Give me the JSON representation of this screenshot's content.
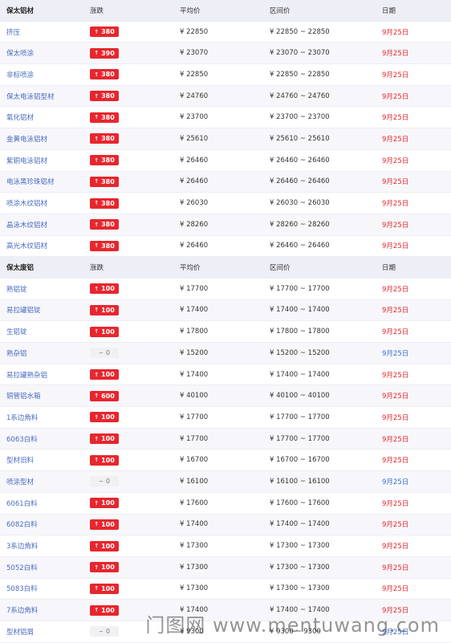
{
  "colors": {
    "up": "#e8262d",
    "header_bg": "#eeeef6",
    "link": "#4a6bbf",
    "date_blue": "#3a6fd8"
  },
  "sections": [
    {
      "header": {
        "name": "保太铝材",
        "change": "涨跌",
        "avg": "平均价",
        "range": "区间价",
        "date": "日期"
      },
      "rows": [
        {
          "name": "挤压",
          "change": "380",
          "dir": "up",
          "avg": "¥ 22850",
          "range": "¥ 22850 ~ 22850",
          "date": "9月25日",
          "date_color": "red"
        },
        {
          "name": "保太喷涂",
          "change": "390",
          "dir": "up",
          "avg": "¥ 23070",
          "range": "¥ 23070 ~ 23070",
          "date": "9月25日",
          "date_color": "red"
        },
        {
          "name": "非标喷涂",
          "change": "380",
          "dir": "up",
          "avg": "¥ 22850",
          "range": "¥ 22850 ~ 22850",
          "date": "9月25日",
          "date_color": "red"
        },
        {
          "name": "保太电泳铝型材",
          "change": "380",
          "dir": "up",
          "avg": "¥ 24760",
          "range": "¥ 24760 ~ 24760",
          "date": "9月25日",
          "date_color": "red"
        },
        {
          "name": "氧化铝材",
          "change": "380",
          "dir": "up",
          "avg": "¥ 23700",
          "range": "¥ 23700 ~ 23700",
          "date": "9月25日",
          "date_color": "red"
        },
        {
          "name": "金黄电泳铝材",
          "change": "380",
          "dir": "up",
          "avg": "¥ 25610",
          "range": "¥ 25610 ~ 25610",
          "date": "9月25日",
          "date_color": "red"
        },
        {
          "name": "紫铜电泳铝材",
          "change": "380",
          "dir": "up",
          "avg": "¥ 26460",
          "range": "¥ 26460 ~ 26460",
          "date": "9月25日",
          "date_color": "red"
        },
        {
          "name": "电泳黑珍珠铝材",
          "change": "380",
          "dir": "up",
          "avg": "¥ 26460",
          "range": "¥ 26460 ~ 26460",
          "date": "9月25日",
          "date_color": "red"
        },
        {
          "name": "喷涂木纹铝材",
          "change": "380",
          "dir": "up",
          "avg": "¥ 26030",
          "range": "¥ 26030 ~ 26030",
          "date": "9月25日",
          "date_color": "red"
        },
        {
          "name": "晶泳木纹铝材",
          "change": "380",
          "dir": "up",
          "avg": "¥ 28260",
          "range": "¥ 28260 ~ 28260",
          "date": "9月25日",
          "date_color": "red"
        },
        {
          "name": "高光木纹铝材",
          "change": "380",
          "dir": "up",
          "avg": "¥ 26460",
          "range": "¥ 26460 ~ 26460",
          "date": "9月25日",
          "date_color": "red"
        }
      ]
    },
    {
      "header": {
        "name": "保太废铝",
        "change": "涨跌",
        "avg": "平均价",
        "range": "区间价",
        "date": "日期"
      },
      "rows": [
        {
          "name": "熟铝锭",
          "change": "100",
          "dir": "up",
          "avg": "¥ 17700",
          "range": "¥ 17700 ~ 17700",
          "date": "9月25日",
          "date_color": "red"
        },
        {
          "name": "易拉罐铝锭",
          "change": "100",
          "dir": "up",
          "avg": "¥ 17400",
          "range": "¥ 17400 ~ 17400",
          "date": "9月25日",
          "date_color": "red"
        },
        {
          "name": "生铝锭",
          "change": "100",
          "dir": "up",
          "avg": "¥ 17800",
          "range": "¥ 17800 ~ 17800",
          "date": "9月25日",
          "date_color": "red"
        },
        {
          "name": "熟杂铝",
          "change": "0",
          "dir": "flat",
          "avg": "¥ 15200",
          "range": "¥ 15200 ~ 15200",
          "date": "9月25日",
          "date_color": "blue"
        },
        {
          "name": "易拉罐熟杂铝",
          "change": "100",
          "dir": "up",
          "avg": "¥ 17400",
          "range": "¥ 17400 ~ 17400",
          "date": "9月25日",
          "date_color": "red"
        },
        {
          "name": "铜管铝水箱",
          "change": "600",
          "dir": "up",
          "avg": "¥ 40100",
          "range": "¥ 40100 ~ 40100",
          "date": "9月25日",
          "date_color": "red"
        },
        {
          "name": "1系边角料",
          "change": "100",
          "dir": "up",
          "avg": "¥ 17700",
          "range": "¥ 17700 ~ 17700",
          "date": "9月25日",
          "date_color": "red"
        },
        {
          "name": "6063白料",
          "change": "100",
          "dir": "up",
          "avg": "¥ 17700",
          "range": "¥ 17700 ~ 17700",
          "date": "9月25日",
          "date_color": "red"
        },
        {
          "name": "型材旧料",
          "change": "100",
          "dir": "up",
          "avg": "¥ 16700",
          "range": "¥ 16700 ~ 16700",
          "date": "9月25日",
          "date_color": "red"
        },
        {
          "name": "喷涂型材",
          "change": "0",
          "dir": "flat",
          "avg": "¥ 16100",
          "range": "¥ 16100 ~ 16100",
          "date": "9月25日",
          "date_color": "blue"
        },
        {
          "name": "6061白料",
          "change": "100",
          "dir": "up",
          "avg": "¥ 17600",
          "range": "¥ 17600 ~ 17600",
          "date": "9月25日",
          "date_color": "red"
        },
        {
          "name": "6082白料",
          "change": "100",
          "dir": "up",
          "avg": "¥ 17400",
          "range": "¥ 17400 ~ 17400",
          "date": "9月25日",
          "date_color": "red"
        },
        {
          "name": "3系边角料",
          "change": "100",
          "dir": "up",
          "avg": "¥ 17300",
          "range": "¥ 17300 ~ 17300",
          "date": "9月25日",
          "date_color": "red"
        },
        {
          "name": "5052白料",
          "change": "100",
          "dir": "up",
          "avg": "¥ 17300",
          "range": "¥ 17300 ~ 17300",
          "date": "9月25日",
          "date_color": "red"
        },
        {
          "name": "5083白料",
          "change": "100",
          "dir": "up",
          "avg": "¥ 17300",
          "range": "¥ 17300 ~ 17300",
          "date": "9月25日",
          "date_color": "red"
        },
        {
          "name": "7系边角料",
          "change": "100",
          "dir": "up",
          "avg": "¥ 17400",
          "range": "¥ 17400 ~ 17400",
          "date": "9月25日",
          "date_color": "red"
        },
        {
          "name": "型材铝屑",
          "change": "0",
          "dir": "flat",
          "avg": "¥ 9300",
          "range": "¥ 9300 ~ 9300",
          "date": "9月25日",
          "date_color": "blue"
        }
      ]
    }
  ],
  "watermark": "门图网 www.mentuwang.com"
}
